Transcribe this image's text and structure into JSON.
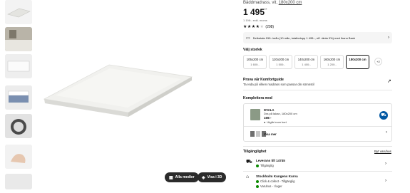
{
  "product": {
    "subtitle": "Bäddmadrass, vit,",
    "size_link": "180x200 cm",
    "price_main": "1 495",
    "price_suffix": ":-",
    "price_note": "1 196:- exkl. moms",
    "rating_count": "(208)",
    "stars_filled": 4,
    "stars_total": 5
  },
  "image_buttons": {
    "all_media": "Alla medier",
    "view_in_3d": "Visa i 3D"
  },
  "finance": {
    "text": "Delbetala 150:-/mån (10 mån, totalbelopp 1 495:-, eff. ränta 0%) med Ikano Bank"
  },
  "sizes": {
    "label": "Välj storlek",
    "options": [
      {
        "size": "105x200 cm",
        "price": "1 600:-"
      },
      {
        "size": "120x200 cm",
        "price": "1 500:-"
      },
      {
        "size": "140x200 cm",
        "price": "1 400:-"
      },
      {
        "size": "160x200 cm",
        "price": "1 200:-"
      },
      {
        "size": "180x200 cm",
        "price": ""
      }
    ],
    "more": "+2"
  },
  "comfort_guide": {
    "title": "Prova vår Komfortguide",
    "subtitle": "Ta reda på vilken madrass som passar din sömnstil"
  },
  "complement": {
    "title": "Komplettera med",
    "item_name": "DVALA",
    "item_desc": "Dra på lakan, 180x200 cm",
    "item_price": "169:-",
    "item_stock": "Utgår inom kort",
    "show_more": "Visa mer"
  },
  "availability": {
    "title": "Tillgänglighet",
    "change_store": "Byt varuhus",
    "delivery": {
      "title": "Leverans till 14745",
      "status": "Tillgänglig"
    },
    "store": {
      "title": "Stockholm Kungens Kurva",
      "click_collect": "Click & collect - Tillgänglig",
      "in_store": "Varuhus - I lager"
    }
  },
  "colors": {
    "accent": "#0058a3",
    "available": "#0a8a00",
    "dark_button": "#2b2b2b"
  }
}
